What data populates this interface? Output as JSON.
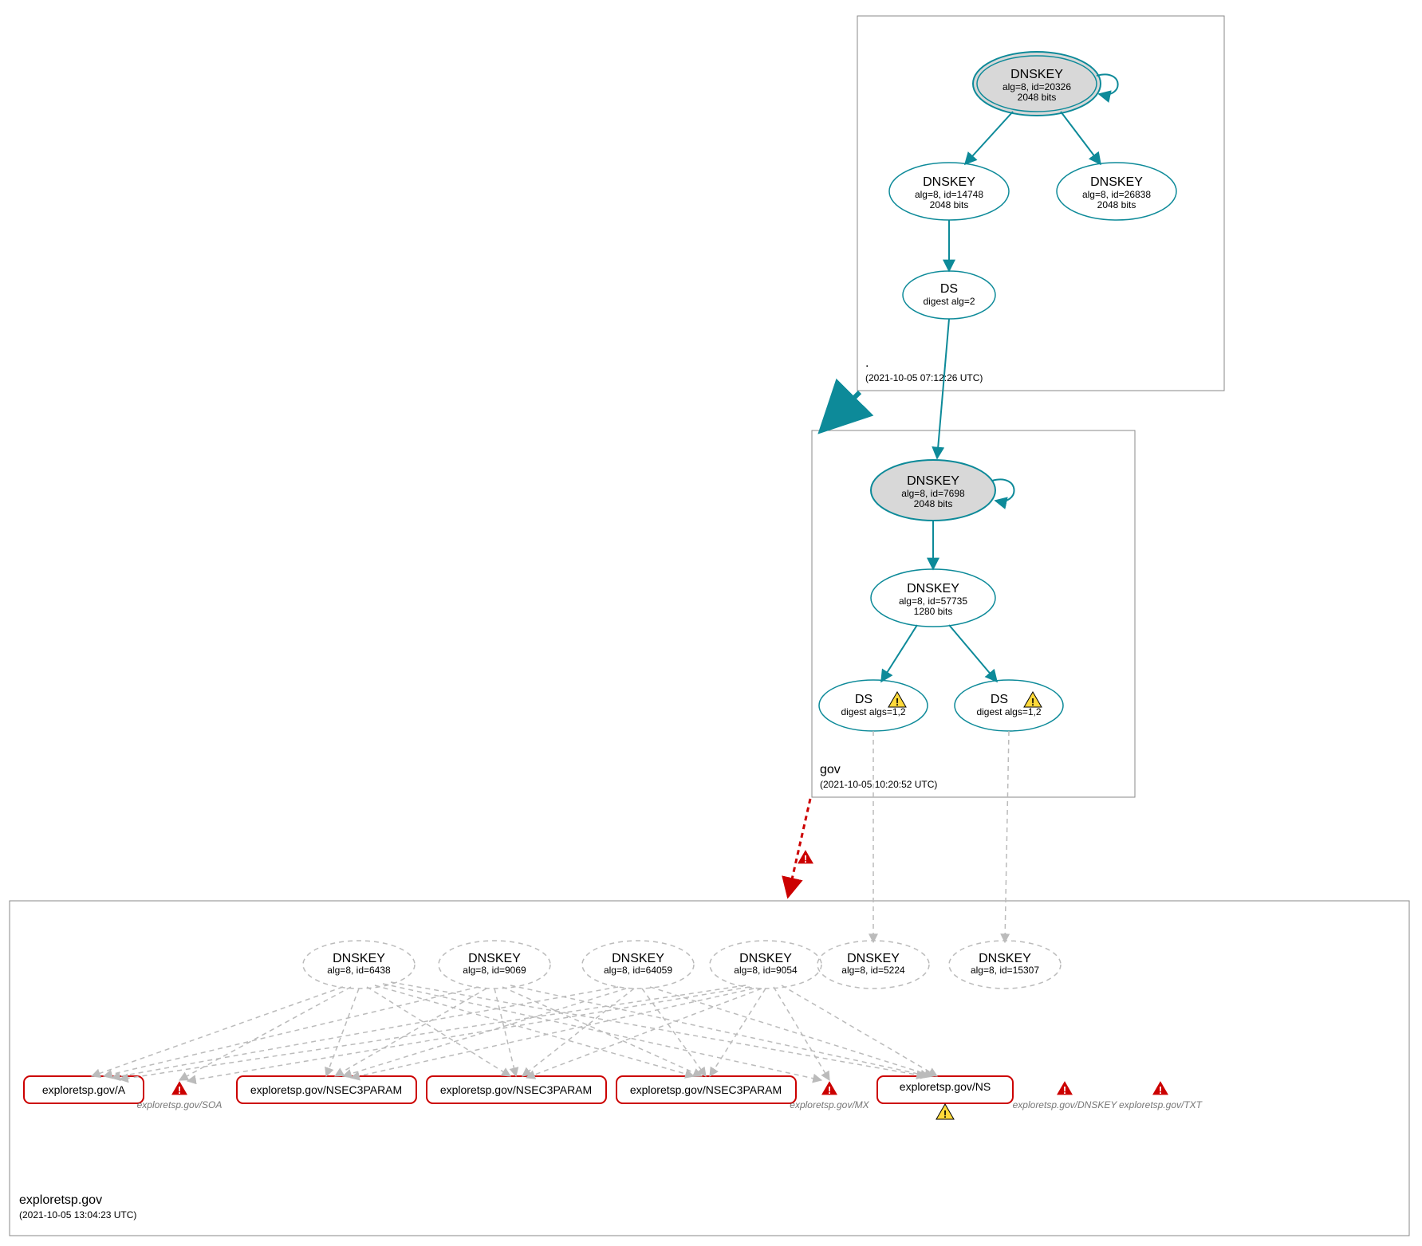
{
  "zones": {
    "root": {
      "label": ".",
      "time": "(2021-10-05 07:12:26 UTC)"
    },
    "gov": {
      "label": "gov",
      "time": "(2021-10-05 10:20:52 UTC)"
    },
    "exploretsp": {
      "label": "exploretsp.gov",
      "time": "(2021-10-05 13:04:23 UTC)"
    }
  },
  "root": {
    "ksk": {
      "title": "DNSKEY",
      "sub1": "alg=8, id=20326",
      "sub2": "2048 bits"
    },
    "zsk1": {
      "title": "DNSKEY",
      "sub1": "alg=8, id=14748",
      "sub2": "2048 bits"
    },
    "zsk2": {
      "title": "DNSKEY",
      "sub1": "alg=8, id=26838",
      "sub2": "2048 bits"
    },
    "ds": {
      "title": "DS",
      "sub1": "digest alg=2"
    }
  },
  "gov": {
    "ksk": {
      "title": "DNSKEY",
      "sub1": "alg=8, id=7698",
      "sub2": "2048 bits"
    },
    "zsk": {
      "title": "DNSKEY",
      "sub1": "alg=8, id=57735",
      "sub2": "1280 bits"
    },
    "ds1": {
      "title": "DS",
      "sub1": "digest algs=1,2"
    },
    "ds2": {
      "title": "DS",
      "sub1": "digest algs=1,2"
    }
  },
  "exploretsp": {
    "k1": {
      "title": "DNSKEY",
      "sub1": "alg=8, id=6438"
    },
    "k2": {
      "title": "DNSKEY",
      "sub1": "alg=8, id=9069"
    },
    "k3": {
      "title": "DNSKEY",
      "sub1": "alg=8, id=64059"
    },
    "k4": {
      "title": "DNSKEY",
      "sub1": "alg=8, id=9054"
    },
    "k5": {
      "title": "DNSKEY",
      "sub1": "alg=8, id=5224"
    },
    "k6": {
      "title": "DNSKEY",
      "sub1": "alg=8, id=15307"
    },
    "rr_a": "exploretsp.gov/A",
    "rr_n1": "exploretsp.gov/NSEC3PARAM",
    "rr_n2": "exploretsp.gov/NSEC3PARAM",
    "rr_n3": "exploretsp.gov/NSEC3PARAM",
    "rr_ns": "exploretsp.gov/NS",
    "ghost_soa": "exploretsp.gov/SOA",
    "ghost_mx": "exploretsp.gov/MX",
    "ghost_dnskey": "exploretsp.gov/DNSKEY",
    "ghost_txt": "exploretsp.gov/TXT"
  }
}
